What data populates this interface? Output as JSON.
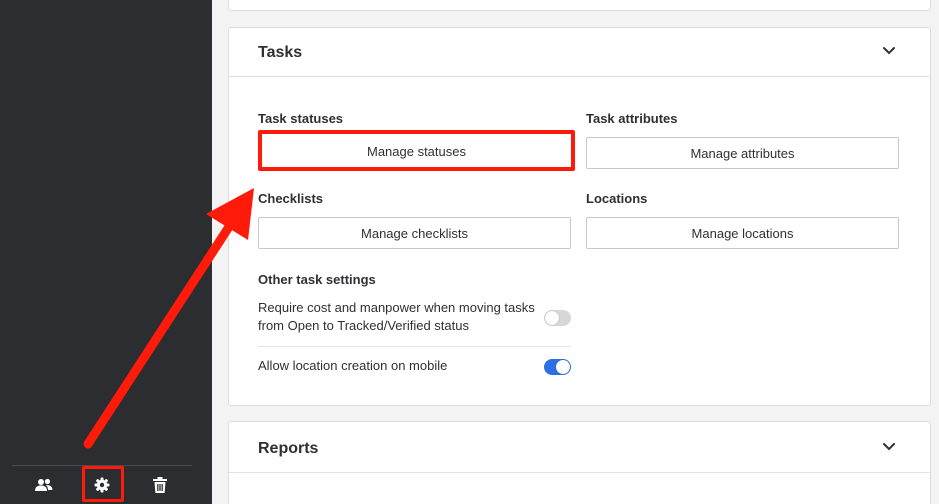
{
  "sidebar": {
    "icons": [
      "users-icon",
      "gear-icon",
      "trash-icon"
    ]
  },
  "tasks": {
    "title": "Tasks",
    "task_statuses": {
      "label": "Task statuses",
      "button": "Manage statuses"
    },
    "task_attributes": {
      "label": "Task attributes",
      "button": "Manage attributes"
    },
    "checklists": {
      "label": "Checklists",
      "button": "Manage checklists"
    },
    "locations": {
      "label": "Locations",
      "button": "Manage locations"
    },
    "other_settings": {
      "label": "Other task settings",
      "require_cost_line1": "Require cost and manpower when moving tasks",
      "require_cost_line2": "from Open to Tracked/Verified status",
      "require_cost_on": false,
      "allow_location": "Allow location creation on mobile",
      "allow_location_on": true
    }
  },
  "reports": {
    "title": "Reports"
  },
  "colors": {
    "highlight": "#ff1a0a",
    "toggle_on": "#2f6fe4",
    "sidebar": "#2c2d30"
  }
}
